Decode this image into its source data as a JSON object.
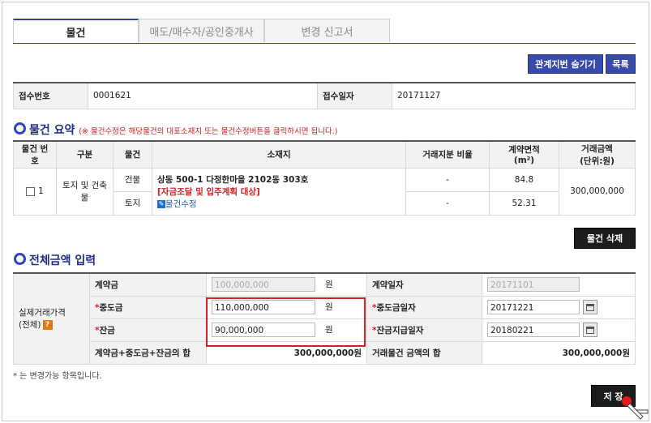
{
  "tabs": [
    "물건",
    "매도/매수자/공인중개사",
    "변경 신고서"
  ],
  "buttons": {
    "toggle_related": "관계지번 숨기기",
    "list": "목록",
    "delete_item": "물건 삭제",
    "save": "저 장"
  },
  "receipt": {
    "number_label": "접수번호",
    "number_value": "0001621",
    "date_label": "접수일자",
    "date_value": "20171127"
  },
  "summary": {
    "title": "물건 요약",
    "note": "(※ 물건수정은 해당물건의 대표소재지 또는 물건수정버튼을 클릭하시면 됩니다.)",
    "headers": {
      "no": "물건 번호",
      "type": "구분",
      "item": "물건",
      "location": "소재지",
      "share": "거래지분 비율",
      "area": "계약면적",
      "area_unit": "(m²)",
      "amount": "거래금액",
      "amount_unit": "(단위:원)"
    },
    "row": {
      "no": "1",
      "type": "토지 및 건축물",
      "item_building": "건물",
      "item_land": "토지",
      "location": "상동 500-1 다정한마을 2102동 303호",
      "location_note": "[자금조달 및 입주계획 대상]",
      "edit_link": "물건수정",
      "share_building": "-",
      "share_land": "-",
      "area_building": "84.8",
      "area_land": "52.31",
      "amount": "300,000,000"
    }
  },
  "total": {
    "title": "전체금액 입력",
    "group_label_1": "실제거래가격",
    "group_label_2": "(전체)",
    "info_icon": "?",
    "deposit_label": "계약금",
    "deposit_value": "100,000,000",
    "unit": "원",
    "contract_date_label": "계약일자",
    "contract_date_value": "20171101",
    "middle_label": "중도금",
    "middle_value": "110,000,000",
    "middle_date_label": "중도금일자",
    "middle_date_value": "20171221",
    "balance_label": "잔금",
    "balance_value": "90,000,000",
    "balance_date_label": "잔금지급일자",
    "balance_date_value": "20180221",
    "sum_label": "계약금+중도금+잔금의 합",
    "sum_value": "300,000,000원",
    "items_sum_label": "거래물건 금액의 합",
    "items_sum_value": "300,000,000원",
    "required_mark": "*",
    "footnote": "* 는 변경가능 항목입니다."
  }
}
